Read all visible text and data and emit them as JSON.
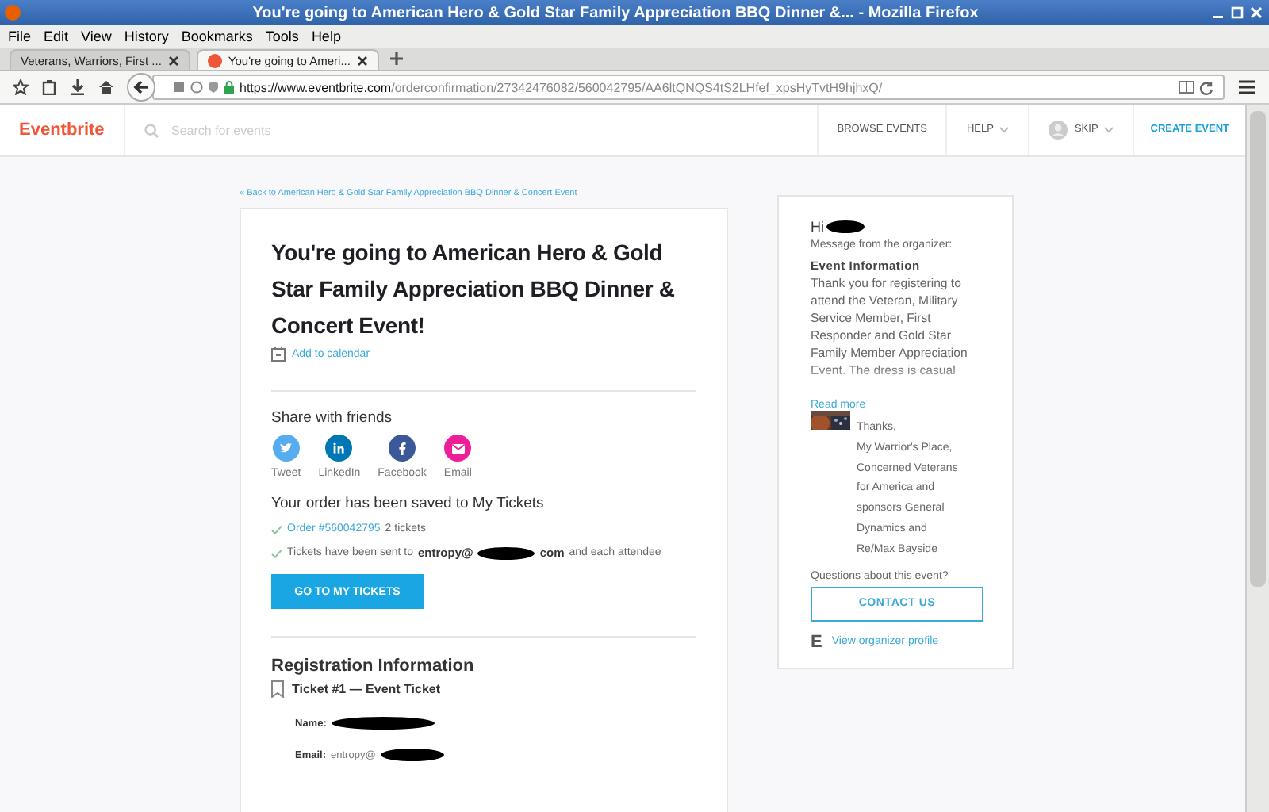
{
  "window": {
    "title": "You're going to American Hero & Gold Star Family Appreciation BBQ Dinner &... - Mozilla Firefox"
  },
  "menu": [
    "File",
    "Edit",
    "View",
    "History",
    "Bookmarks",
    "Tools",
    "Help"
  ],
  "tabs": [
    {
      "label": "Veterans, Warriors, First ...",
      "selected": false,
      "kind": "plain"
    },
    {
      "label": "You're going to Ameri...",
      "selected": true,
      "kind": "site"
    }
  ],
  "address": {
    "scheme": "https://www.",
    "domain": "eventbrite.com",
    "path": "/orderconfirmation/27342476082/560042795/AA6ltQNQS4tS2LHfef_xpsHyTvtH9hjhxQ/"
  },
  "site_header": {
    "logo": "Eventbrite",
    "search_placeholder": "Search for events",
    "nav": [
      {
        "label": "BROWSE EVENTS",
        "kind": "link"
      },
      {
        "label": "HELP",
        "kind": "dropdown"
      },
      {
        "label": "SKIP",
        "kind": "user"
      },
      {
        "label": "CREATE EVENT",
        "kind": "primary"
      }
    ]
  },
  "back_link": "« Back to American Hero & Gold Star Family Appreciation BBQ Dinner & Concert Event",
  "main": {
    "title": "You're going to American Hero & Gold Star Family Appreciation BBQ Dinner & Concert Event!",
    "add_to_calendar": "Add to calendar",
    "share_heading": "Share with friends",
    "share": [
      {
        "label": "Tweet",
        "kind": "twitter",
        "color": "#55acee"
      },
      {
        "label": "LinkedIn",
        "kind": "linkedin",
        "color": "#0077b5"
      },
      {
        "label": "Facebook",
        "kind": "facebook",
        "color": "#3b5998"
      },
      {
        "label": "Email",
        "kind": "email",
        "color": "#ee1e99"
      }
    ],
    "order_heading": "Your order has been saved to My Tickets",
    "order_link": "Order #560042795",
    "order_count": "2 tickets",
    "sent_prefix": "Tickets have been sent to",
    "sent_email_start": "entropy@",
    "sent_email_end": "com",
    "sent_suffix": "and each attendee",
    "button": "GO TO MY TICKETS",
    "registration_heading": "Registration Information",
    "ticket_heading": "Ticket #1 — Event Ticket",
    "fields": [
      {
        "label": "Name:"
      },
      {
        "label": "Email:",
        "value": "entropy@"
      }
    ]
  },
  "sidebar": {
    "greeting": "Hi",
    "message_label": "Message from the organizer:",
    "info_heading": "Event Information",
    "info_text": "Thank you for registering to attend the Veteran, Military Service Member, First Responder and Gold Star Family Member Appreciation Event. The dress is casual",
    "read_more": "Read more",
    "signature": [
      "Thanks,",
      "My Warrior's Place,",
      "Concerned Veterans",
      "for America and",
      "sponsors General",
      "Dynamics and",
      "Re/Max Bayside"
    ],
    "questions": "Questions about this event?",
    "contact": "CONTACT US",
    "profile_logo": "E",
    "profile_link": "View organizer profile"
  }
}
